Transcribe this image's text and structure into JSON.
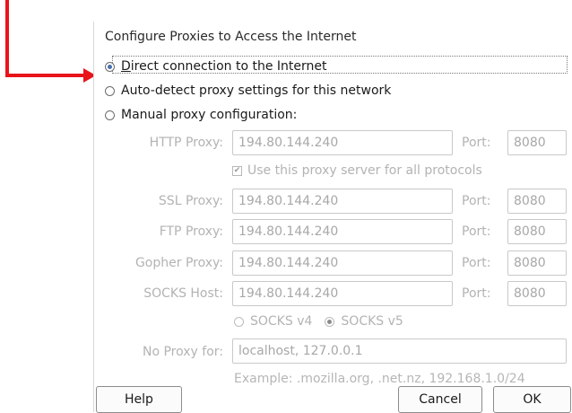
{
  "title": "Configure Proxies to Access the Internet",
  "options": {
    "direct": "Direct connection to the Internet",
    "auto": "Auto-detect proxy settings for this network",
    "manual": "Manual proxy configuration:"
  },
  "proxies": {
    "http": {
      "label": "HTTP Proxy:",
      "host": "194.80.144.240",
      "port": "8080"
    },
    "ssl": {
      "label": "SSL Proxy:",
      "host": "194.80.144.240",
      "port": "8080"
    },
    "ftp": {
      "label": "FTP Proxy:",
      "host": "194.80.144.240",
      "port": "8080"
    },
    "gopher": {
      "label": "Gopher Proxy:",
      "host": "194.80.144.240",
      "port": "8080"
    },
    "socks": {
      "label": "SOCKS Host:",
      "host": "194.80.144.240",
      "port": "8080"
    },
    "port_label": "Port:"
  },
  "use_same_proxy": "Use this proxy server for all protocols",
  "socks_versions": {
    "v4": "SOCKS v4",
    "v5": "SOCKS v5"
  },
  "no_proxy": {
    "label": "No Proxy for:",
    "value": "localhost, 127.0.0.1"
  },
  "example": "Example: .mozilla.org, .net.nz, 192.168.1.0/24",
  "buttons": {
    "help": "Help",
    "cancel": "Cancel",
    "ok": "OK"
  }
}
